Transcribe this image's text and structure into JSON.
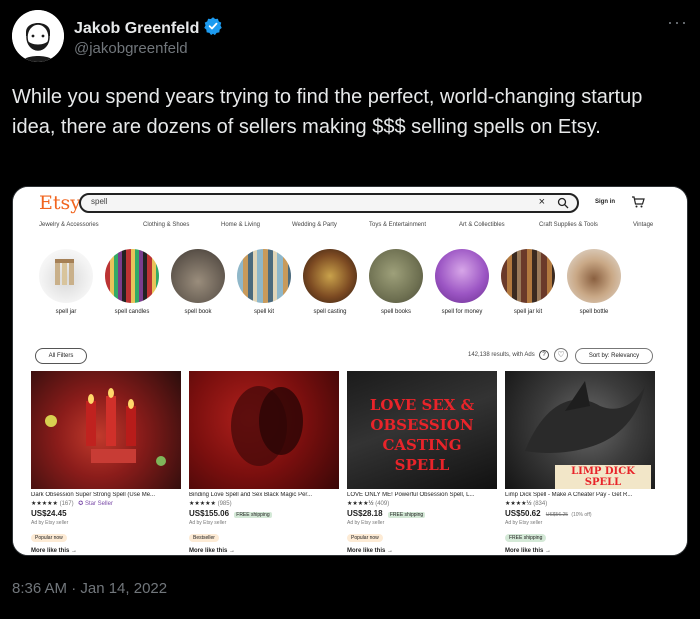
{
  "author": {
    "display_name": "Jakob Greenfeld",
    "handle": "@jakobgreenfeld"
  },
  "more_label": "···",
  "tweet_text": "While you spend years trying to find the perfect, world-changing startup idea, there are dozens of sellers making $$$ selling spells on Etsy.",
  "timestamp": "8:36 AM · Jan 14, 2022",
  "colors": {
    "background": "#000000",
    "verified": "#1d9bf0",
    "etsy_brand": "#f1641e"
  },
  "etsy": {
    "logo": "Etsy",
    "search_value": "spell",
    "clear_label": "×",
    "sign_in": "Sign in",
    "categories": [
      "Jewelry & Accessories",
      "Clothing & Shoes",
      "Home & Living",
      "Wedding & Party",
      "Toys & Entertainment",
      "Art & Collectibles",
      "Craft Supplies & Tools",
      "Vintage"
    ],
    "suggestions": [
      {
        "label": "spell jar"
      },
      {
        "label": "spell candles"
      },
      {
        "label": "spell book"
      },
      {
        "label": "spell kit"
      },
      {
        "label": "spell casting"
      },
      {
        "label": "spell books"
      },
      {
        "label": "spell for money"
      },
      {
        "label": "spell jar kit"
      },
      {
        "label": "spell bottle"
      }
    ],
    "filters_label": "All Filters",
    "results_text": "142,138 results, with Ads",
    "sort_label": "Sort by: Relevancy",
    "listings": [
      {
        "title": "Dark Obsession Super Strong Spell (Use Me...",
        "stars": "★★★★★",
        "review_count": "(167)",
        "star_seller": "✪ Star Seller",
        "price": "US$24.45",
        "free_shipping": "",
        "old_price": "",
        "discount": "",
        "ad_text": "Ad by Etsy seller",
        "badge": "Popular now",
        "more": "More like this →"
      },
      {
        "title": "Binding Love Spell and Sex Black Magic Per...",
        "stars": "★★★★★",
        "review_count": "(985)",
        "star_seller": "",
        "price": "US$155.06",
        "free_shipping": "FREE shipping",
        "old_price": "",
        "discount": "",
        "ad_text": "Ad by Etsy seller",
        "badge": "Bestseller",
        "more": "More like this →"
      },
      {
        "title": "LOVE ONLY ME! Powerful Obsession Spell, L...",
        "stars": "★★★★½",
        "review_count": "(409)",
        "star_seller": "",
        "price": "US$28.18",
        "free_shipping": "FREE shipping",
        "old_price": "",
        "discount": "",
        "ad_text": "Ad by Etsy seller",
        "badge": "Popular now",
        "more": "More like this →",
        "image_text": "LOVE SEX & OBSESSION CASTING SPELL"
      },
      {
        "title": "Limp Dick Spell - Make A Cheater Pay - Get R...",
        "stars": "★★★★½",
        "review_count": "(834)",
        "star_seller": "",
        "price": "US$50.62",
        "free_shipping": "",
        "old_price": "US$56.25",
        "discount": "(10% off)",
        "ad_text": "Ad by Etsy seller",
        "badge": "FREE shipping",
        "more": "More like this →",
        "image_text": "LIMP DICK SPELL"
      }
    ]
  }
}
